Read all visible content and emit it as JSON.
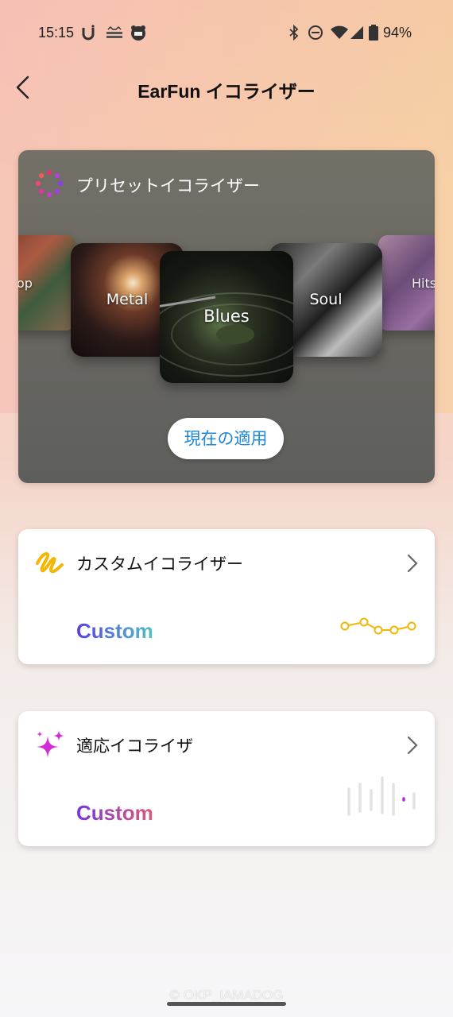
{
  "status_bar": {
    "time": "15:15",
    "battery": "94%",
    "icons": [
      "u-app-icon",
      "hello-cycling-icon",
      "map-app-icon",
      "bluetooth-icon",
      "dnd-icon",
      "wifi-icon",
      "signal-icon",
      "battery-icon"
    ]
  },
  "header": {
    "title": "EarFun イコライザー",
    "back_icon": "chevron-left-icon"
  },
  "preset": {
    "title": "プリセットイコライザー",
    "albums": [
      {
        "label": "Hip-Hop",
        "visible_label": "p-Hop"
      },
      {
        "label": "Metal"
      },
      {
        "label": "Blues",
        "selected": true
      },
      {
        "label": "Soul"
      },
      {
        "label": "Hits"
      }
    ],
    "apply_label": "現在の適用"
  },
  "custom_eq": {
    "title": "カスタムイコライザー",
    "value": "Custom",
    "icon": "squiggle-icon",
    "accent": "#f2b705"
  },
  "adaptive_eq": {
    "title": "適応イコライザ",
    "value": "Custom",
    "icon": "sparkle-icon",
    "accent": "#d42ad8"
  },
  "watermark": "© OKP_IAMADOG"
}
